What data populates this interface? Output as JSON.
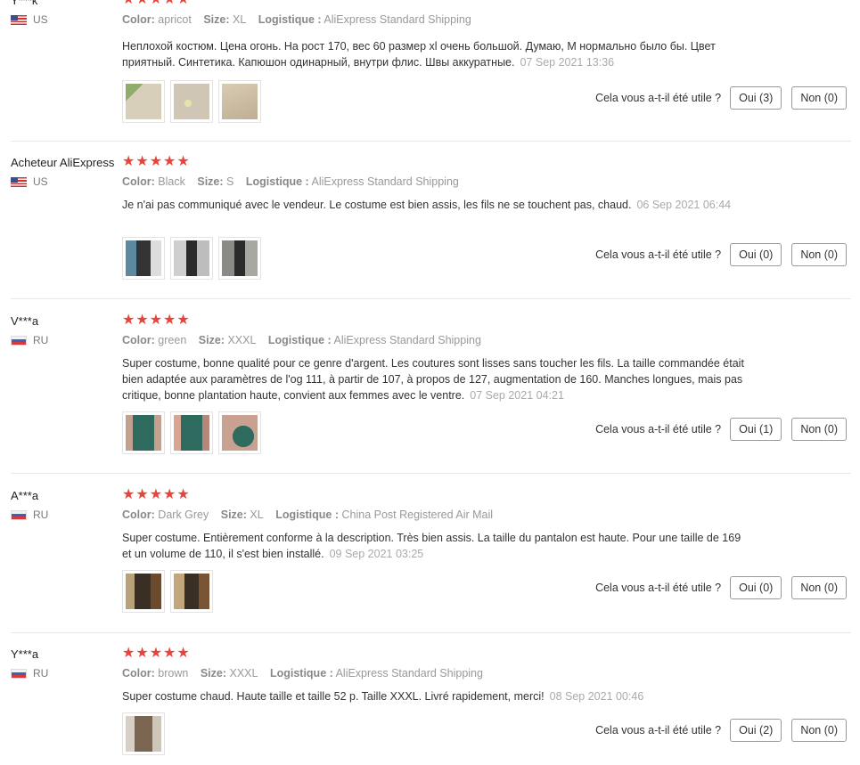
{
  "labels": {
    "color": "Color:",
    "size": "Size:",
    "logistics": "Logistique :",
    "helpful_question": "Cela vous a-t-il été utile ?"
  },
  "colors": {
    "star": "#e8443b",
    "border": "#e8e8e8"
  },
  "reviews": [
    {
      "user": "Y***k",
      "country": "US",
      "flag_icon": "us-flag-icon",
      "stars": "★★★★★",
      "color": "apricot",
      "size": "XL",
      "logistics": "AliExpress Standard Shipping",
      "text": "Неплохой костюм. Цена огонь. На рост 170, вес 60 размер xl очень большой. Думаю, М нормально было бы. Цвет приятный. Синтетика. Капюшон одинарный, внутри флис. Швы аккуратные.",
      "date": "07 Sep 2021 13:36",
      "yes_label": "Oui (3)",
      "no_label": "Non (0)",
      "photo_tones": [
        "#c9c1a7",
        "#cfc6b6",
        "#cdbfa7"
      ]
    },
    {
      "user": "Acheteur AliExpress",
      "country": "US",
      "flag_icon": "us-flag-icon",
      "stars": "★★★★★",
      "color": "Black",
      "size": "S",
      "logistics": "AliExpress Standard Shipping",
      "text": "Je n'ai pas communiqué avec le vendeur. Le costume est bien assis, les fils ne se touchent pas, chaud.",
      "date": "06 Sep 2021 06:44",
      "yes_label": "Oui (0)",
      "no_label": "Non (0)",
      "photo_tones": [
        "#5b6770",
        "#6d6a66",
        "#6f706c"
      ]
    },
    {
      "user": "V***a",
      "country": "RU",
      "flag_icon": "ru-flag-icon",
      "stars": "★★★★★",
      "color": "green",
      "size": "XXXL",
      "logistics": "AliExpress Standard Shipping",
      "text": "Super costume, bonne qualité pour ce genre d'argent. Les coutures sont lisses sans toucher les fils. La taille commandée était bien adaptée aux paramètres de l'og 111, à partir de 107, à propos de 127, augmentation de 160. Manches longues, mais pas critique, bonne plantation haute, convient aux femmes avec le ventre.",
      "date": "07 Sep 2021 04:21",
      "yes_label": "Oui (1)",
      "no_label": "Non (0)",
      "photo_tones": [
        "#2f6a5e",
        "#a36f60",
        "#8a6d5f"
      ]
    },
    {
      "user": "A***a",
      "country": "RU",
      "flag_icon": "ru-flag-icon",
      "stars": "★★★★★",
      "color": "Dark Grey",
      "size": "XL",
      "logistics": "China Post Registered Air Mail",
      "text": "Super costume. Entièrement conforme à la description. Très bien assis. La taille du pantalon est haute. Pour une taille de 169 et un volume de 110, il s'est bien installé.",
      "date": "09 Sep 2021 03:25",
      "yes_label": "Oui (0)",
      "no_label": "Non (0)",
      "photo_tones": [
        "#6b4a2e",
        "#7a5534"
      ]
    },
    {
      "user": "Y***a",
      "country": "RU",
      "flag_icon": "ru-flag-icon",
      "stars": "★★★★★",
      "color": "brown",
      "size": "XXXL",
      "logistics": "AliExpress Standard Shipping",
      "text": "Super costume chaud. Haute taille et taille 52 p. Taille XXXL. Livré rapidement, merci!",
      "date": "08 Sep 2021 00:46",
      "yes_label": "Oui (2)",
      "no_label": "Non (0)",
      "photo_tones": [
        "#7a6650"
      ]
    }
  ]
}
